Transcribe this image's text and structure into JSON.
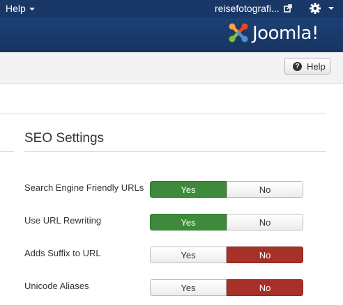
{
  "topbar": {
    "help_menu": "Help",
    "site_name": "reisefotografi..."
  },
  "header": {
    "logo_text": "Joomla!"
  },
  "toolbar": {
    "help_button": "Help"
  },
  "section": {
    "title": "SEO Settings"
  },
  "settings": [
    {
      "label": "Search Engine Friendly URLs",
      "yes": "Yes",
      "no": "No",
      "selected": "Yes"
    },
    {
      "label": "Use URL Rewriting",
      "yes": "Yes",
      "no": "No",
      "selected": "Yes"
    },
    {
      "label": "Adds Suffix to URL",
      "yes": "Yes",
      "no": "No",
      "selected": "No"
    },
    {
      "label": "Unicode Aliases",
      "yes": "Yes",
      "no": "No",
      "selected": "No"
    }
  ],
  "colors": {
    "navbar": "#1a3867",
    "yes_active": "#3d8a3a",
    "no_active": "#a63128"
  }
}
